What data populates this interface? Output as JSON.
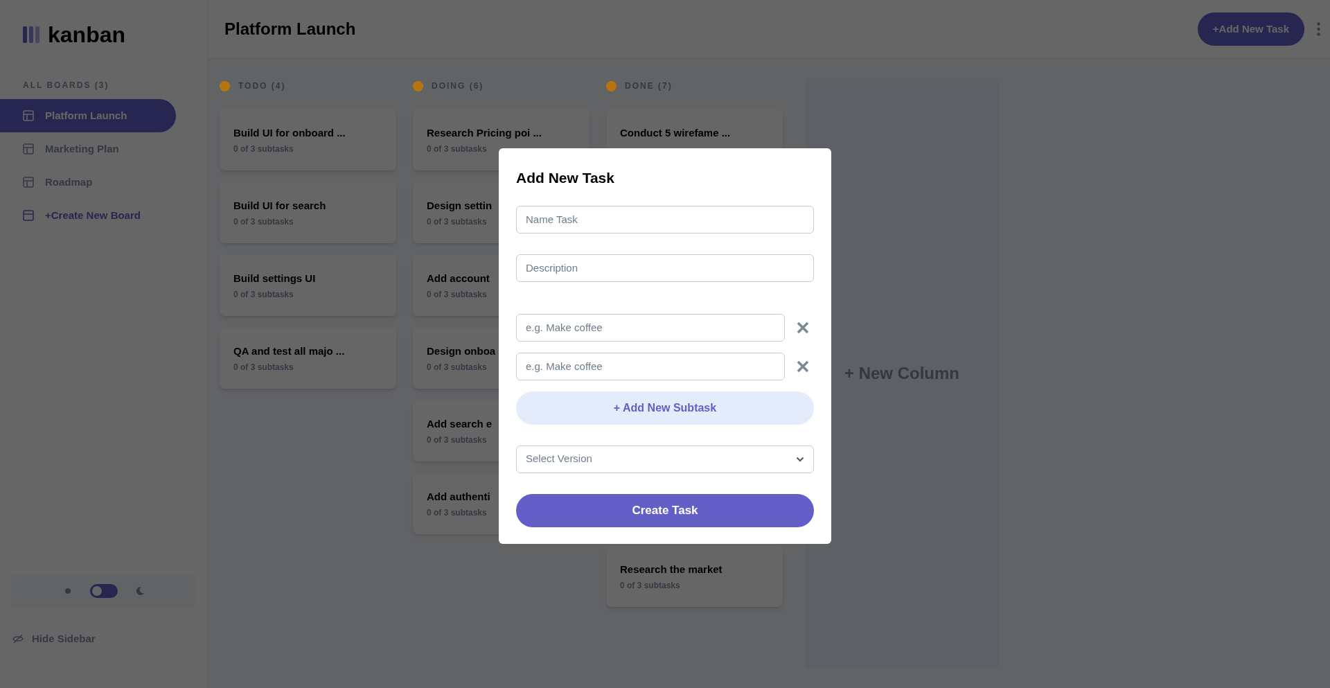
{
  "sidebar": {
    "logo": "kanban",
    "boards_heading": "ALL BOARDS (3)",
    "boards": [
      {
        "label": "Platform Launch",
        "selected": true
      },
      {
        "label": "Marketing Plan",
        "selected": false
      },
      {
        "label": "Roadmap",
        "selected": false
      }
    ],
    "create_board": "+Create New Board",
    "dark_mode": false,
    "hide_sidebar": "Hide Sidebar"
  },
  "header": {
    "title": "Platform Launch",
    "add_task": "+Add New Task"
  },
  "columns": [
    {
      "title": "TODO (4)",
      "color": "#b8740f",
      "cards": [
        {
          "title": "Build UI for onboard ...",
          "subtasks": "0 of 3 subtasks"
        },
        {
          "title": "Build UI for search",
          "subtasks": "0 of 3 subtasks"
        },
        {
          "title": "Build settings UI",
          "subtasks": "0 of 3 subtasks"
        },
        {
          "title": "QA and test all majo ...",
          "subtasks": "0 of 3 subtasks"
        }
      ]
    },
    {
      "title": "DOING (6)",
      "color": "#b8740f",
      "cards": [
        {
          "title": "Research Pricing poi ...",
          "subtasks": "0 of 3 subtasks"
        },
        {
          "title": "Design settin",
          "subtasks": "0 of 3 subtasks"
        },
        {
          "title": "Add account",
          "subtasks": "0 of 3 subtasks"
        },
        {
          "title": "Design onboa",
          "subtasks": "0 of 3 subtasks"
        },
        {
          "title": "Add search e",
          "subtasks": "0 of 3 subtasks"
        },
        {
          "title": "Add authenti",
          "subtasks": "0 of 3 subtasks"
        }
      ]
    },
    {
      "title": "DONE (7)",
      "color": "#b8740f",
      "cards": [
        {
          "kind": "card",
          "title": "Conduct 5 wirefame ..."
        },
        {
          "kind": "card_after_gap",
          "title": "Research the market",
          "subtasks": "0 of 3 subtasks"
        }
      ]
    }
  ],
  "new_column": "+ New Column",
  "modal": {
    "title": "Add New Task",
    "name_placeholder": "Name Task",
    "description_placeholder": "Description",
    "subtasks": [
      {
        "placeholder": "e.g. Make coffee"
      },
      {
        "placeholder": "e.g. Make coffee"
      }
    ],
    "add_subtask": "+ Add New Subtask",
    "select_placeholder": "Select Version",
    "submit": "Create Task"
  }
}
